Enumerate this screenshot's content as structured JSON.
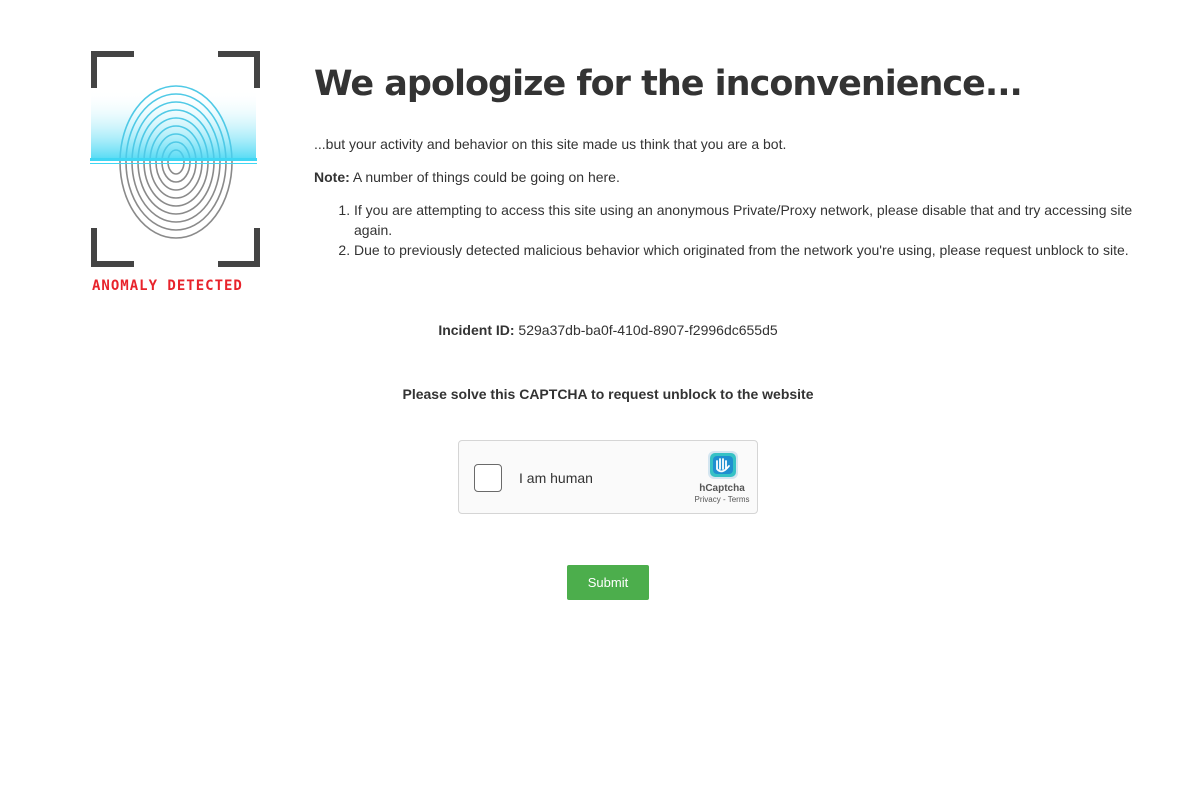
{
  "logo": {
    "text": "ANOMALY DETECTED",
    "icon": "fingerprint-scan-icon",
    "colors": {
      "frame": "#444444",
      "scan": "#3fd6f3",
      "text": "#e8232b"
    }
  },
  "heading": "We apologize for the inconvenience...",
  "intro": "...but your activity and behavior on this site made us think that you are a bot.",
  "note": {
    "label": "Note:",
    "text": " A number of things could be going on here."
  },
  "reasons": [
    "If you are attempting to access this site using an anonymous Private/Proxy network, please disable that and try accessing site again.",
    "Due to previously detected malicious behavior which originated from the network you're using, please request unblock to site."
  ],
  "incident": {
    "label": "Incident ID:",
    "id": " 529a37db-ba0f-410d-8907-f2996dc655d5"
  },
  "captcha_prompt": "Please solve this CAPTCHA to request unblock to the website",
  "hcaptcha": {
    "label": "I am human",
    "brand": "hCaptcha",
    "privacy": "Privacy",
    "separator": " - ",
    "terms": "Terms",
    "checked": false
  },
  "submit": {
    "label": "Submit",
    "color": "#4cae4c"
  }
}
